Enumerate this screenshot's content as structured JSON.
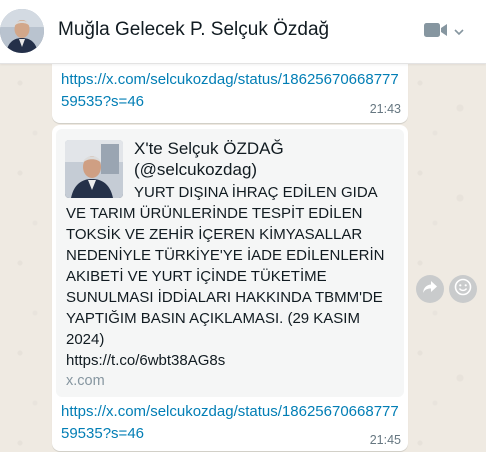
{
  "header": {
    "contact_name": "Muğla Gelecek P. Selçuk Özdağ",
    "video_icon": "video-camera-icon",
    "dropdown_icon": "chevron-down-icon"
  },
  "messages": [
    {
      "link": "https://x.com/selcukozdag/status/1862567066877759535?s=46",
      "time": "21:43"
    },
    {
      "preview": {
        "title": "X'te Selçuk ÖZDAĞ (@selcukozdag)",
        "description": "YURT DIŞINA İHRAÇ EDİLEN GIDA VE TARIM ÜRÜNLERİNDE TESPİT EDİLEN TOKSİK VE ZEHİR İÇEREN KİMYASALLAR NEDENİYLE TÜRKİYE'YE İADE EDİLENLERİN AKIBETİ VE YURT İÇİNDE TÜKETİME SUNULMASI İDDİALARI HAKKINDA TBMM'DE YAPTIĞIM BASIN AÇIKLAMASI. (29 KASIM 2024)",
        "short_url": "https://t.co/6wbt38AG8s",
        "domain": "x.com"
      },
      "link": "https://x.com/selcukozdag/status/1862567066877759535?s=46",
      "time": "21:45"
    }
  ],
  "side_actions": {
    "forward_icon": "forward-icon",
    "react_icon": "emoji-reaction-icon"
  },
  "colors": {
    "link": "#027eb5",
    "chat_background": "#efeae2",
    "bubble": "#ffffff"
  }
}
